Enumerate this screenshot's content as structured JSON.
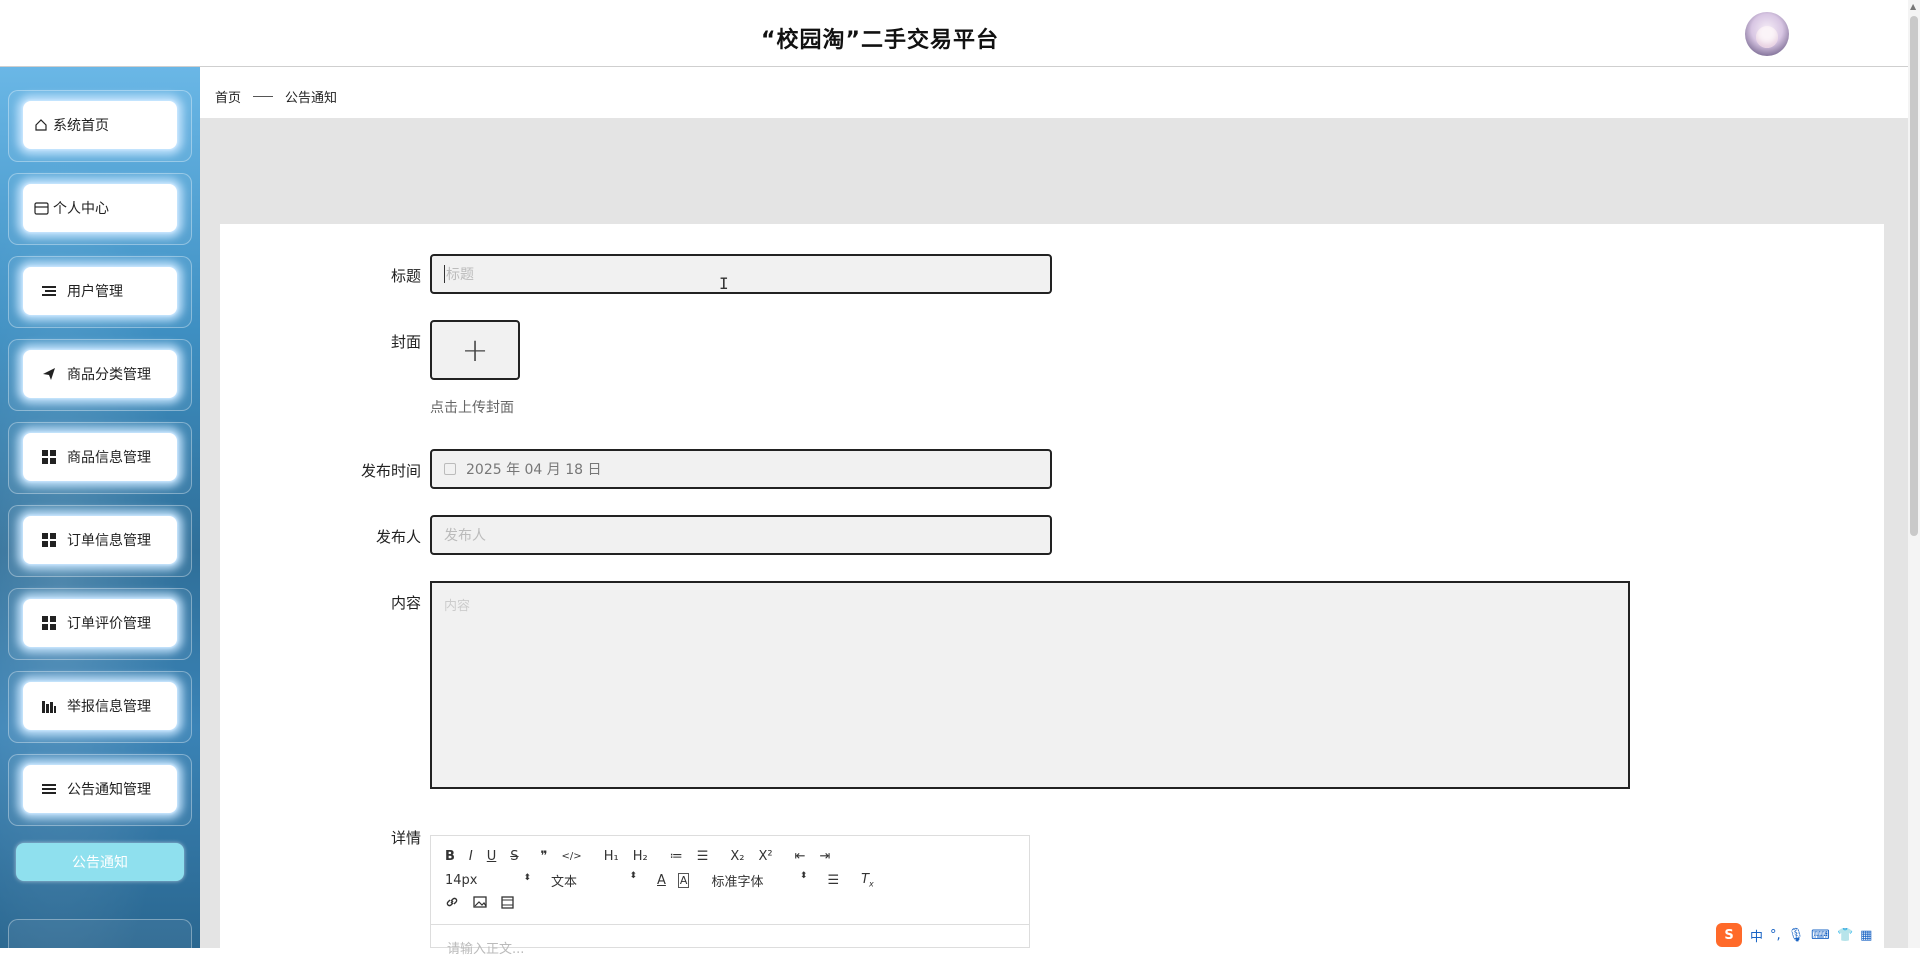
{
  "header": {
    "title": "“校园淘”二手交易平台"
  },
  "sidebar": {
    "items": [
      {
        "label": "系统首页",
        "icon": "home-icon"
      },
      {
        "label": "个人中心",
        "icon": "card-icon"
      },
      {
        "label": "用户管理",
        "icon": "list-icon"
      },
      {
        "label": "商品分类管理",
        "icon": "send-icon"
      },
      {
        "label": "商品信息管理",
        "icon": "grid-icon"
      },
      {
        "label": "订单信息管理",
        "icon": "grid-icon"
      },
      {
        "label": "订单评价管理",
        "icon": "grid-icon"
      },
      {
        "label": "举报信息管理",
        "icon": "bar-chart-icon"
      },
      {
        "label": "公告通知管理",
        "icon": "menu-icon"
      }
    ],
    "sub_item": "公告通知"
  },
  "breadcrumb": {
    "home": "首页",
    "current": "公告通知"
  },
  "form": {
    "title_label": "标题",
    "title_placeholder": "标题",
    "cover_label": "封面",
    "cover_plus": "+",
    "cover_hint": "点击上传封面",
    "time_label": "发布时间",
    "time_value": "2025 年 04 月 18 日",
    "publisher_label": "发布人",
    "publisher_placeholder": "发布人",
    "content_label": "内容",
    "content_placeholder": "内容",
    "detail_label": "详情"
  },
  "editor": {
    "row1": [
      "B",
      "I",
      "U",
      "S",
      "❞",
      "</>",
      "H₁",
      "H₂",
      "≔",
      "☰",
      "X₂",
      "X²",
      "⇤",
      "⇥"
    ],
    "font_size": "14px",
    "text_style": "文本",
    "font_family": "标准字体",
    "body_placeholder": "请输入正文..."
  },
  "ime": {
    "logo": "S",
    "lang": "中"
  }
}
